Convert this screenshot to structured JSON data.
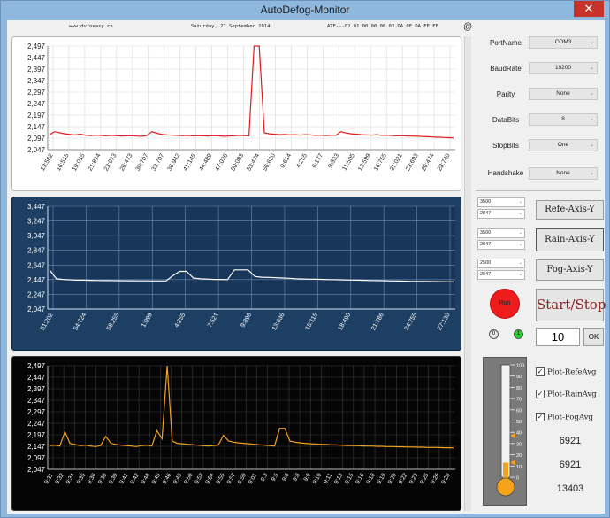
{
  "window": {
    "title": "AutoDefog-Monitor",
    "close_glyph": "✕"
  },
  "infobar": {
    "site": "www.dvfoeasy.cn",
    "date": "Saturday, 27 September 2014",
    "packet": "ATE---02 01 00 00 00 03 DA 0E DA EE EF",
    "at_symbol": "@"
  },
  "serial": [
    {
      "label": "PortName",
      "value": "COM3"
    },
    {
      "label": "BaudRate",
      "value": "19200"
    },
    {
      "label": "Parity",
      "value": "None"
    },
    {
      "label": "DataBits",
      "value": "8"
    },
    {
      "label": "StopBits",
      "value": "One"
    },
    {
      "label": "Handshake",
      "value": "None"
    }
  ],
  "axis_controls": [
    {
      "max": "3500",
      "min": "2047",
      "button": "Refe-Axis-Y"
    },
    {
      "max": "3500",
      "min": "2047",
      "button": "Rain-Axis-Y"
    },
    {
      "max": "2500",
      "min": "2047",
      "button": "Fog-Axis-Y"
    }
  ],
  "run": {
    "label": "Run",
    "start_stop": "Start/Stop",
    "dot1": "0",
    "dot2": "1",
    "interval": "10",
    "ok": "OK"
  },
  "plot_options": [
    {
      "label": "Plot-RefeAvg",
      "checked": true,
      "mark": "✓"
    },
    {
      "label": "Plot-RainAvg",
      "checked": true,
      "mark": "✓"
    },
    {
      "label": "Plot-FogAvg",
      "checked": true,
      "mark": "✓"
    }
  ],
  "averages": [
    "6921",
    "6921",
    "13403"
  ],
  "thermometer": {
    "ticks": [
      "100",
      "90",
      "80",
      "70",
      "60",
      "50",
      "40",
      "30",
      "20",
      "10",
      "0"
    ],
    "level": 0.13,
    "marker_high": 0.37
  },
  "colors": {
    "refe_line": "#e01a1a",
    "rain_line": "#ffffff",
    "fog_line": "#f3a21c",
    "rain_bg": "#1d3f64",
    "fog_bg": "#050505"
  },
  "chart_data": [
    {
      "type": "line",
      "name": "refe",
      "ylim": [
        2047,
        2497
      ],
      "yticks": [
        "2,497",
        "2,447",
        "2,397",
        "2,347",
        "2,297",
        "2,247",
        "2,197",
        "2,147",
        "2,097",
        "2,047"
      ],
      "xticks": [
        "13:562",
        "16:515",
        "19:015",
        "21:874",
        "23:973",
        "26:473",
        "30:707",
        "33:707",
        "36:942",
        "41:145",
        "44:489",
        "47:036",
        "50:083",
        "53:474",
        "56:630",
        "0:614",
        "4:255",
        "6:177",
        "9:333",
        "11:505",
        "13:599",
        "16:755",
        "21:021",
        "23:693",
        "26:474",
        "28:740"
      ],
      "values": [
        2112,
        2125,
        2120,
        2116,
        2113,
        2111,
        2114,
        2110,
        2108,
        2110,
        2109,
        2107,
        2109,
        2108,
        2106,
        2107,
        2108,
        2106,
        2105,
        2108,
        2125,
        2118,
        2113,
        2111,
        2110,
        2109,
        2108,
        2109,
        2107,
        2108,
        2107,
        2106,
        2108,
        2107,
        2105,
        2106,
        2107,
        2109,
        2108,
        2107,
        2497,
        2497,
        2120,
        2116,
        2114,
        2112,
        2113,
        2111,
        2112,
        2110,
        2112,
        2111,
        2109,
        2110,
        2108,
        2110,
        2109,
        2125,
        2119,
        2116,
        2114,
        2112,
        2111,
        2110,
        2112,
        2109,
        2110,
        2108,
        2107,
        2108,
        2106,
        2106,
        2105,
        2104,
        2103,
        2102,
        2101,
        2100,
        2099,
        2098
      ]
    },
    {
      "type": "line",
      "name": "rain",
      "ylim": [
        2047,
        3447
      ],
      "yticks": [
        "3,447",
        "3,247",
        "3,047",
        "2,847",
        "2,647",
        "2,447",
        "2,247",
        "2,047"
      ],
      "xticks": [
        "51:202",
        "54:724",
        "58:255",
        "1:099",
        "4:255",
        "7:521",
        "9:896",
        "13:036",
        "15:115",
        "18:490",
        "21:786",
        "24:755",
        "27:130"
      ],
      "values": [
        2580,
        2460,
        2450,
        2445,
        2440,
        2440,
        2438,
        2436,
        2435,
        2434,
        2433,
        2432,
        2432,
        2431,
        2431,
        2430,
        2430,
        2430,
        2500,
        2560,
        2560,
        2470,
        2460,
        2455,
        2450,
        2450,
        2448,
        2580,
        2580,
        2580,
        2490,
        2480,
        2478,
        2474,
        2470,
        2466,
        2460,
        2456,
        2454,
        2452,
        2450,
        2448,
        2446,
        2444,
        2442,
        2440,
        2438,
        2436,
        2434,
        2432,
        2430,
        2428,
        2426,
        2424,
        2423,
        2422,
        2421,
        2420,
        2419,
        2418
      ]
    },
    {
      "type": "line",
      "name": "fog",
      "ylim": [
        2047,
        2497
      ],
      "yticks": [
        "2,497",
        "2,447",
        "2,397",
        "2,347",
        "2,297",
        "2,247",
        "2,197",
        "2,147",
        "2,097",
        "2,047"
      ],
      "xticks": [
        "9:31",
        "9:32",
        "9:34",
        "9:35",
        "9:36",
        "9:38",
        "9:39",
        "9:41",
        "9:42",
        "9:44",
        "9:45",
        "9:46",
        "9:48",
        "9:50",
        "9:52",
        "9:54",
        "9:55",
        "9:57",
        "9:59",
        "9:01",
        "9:3",
        "9:5",
        "9:6",
        "9:8",
        "9:9",
        "9:10",
        "9:11",
        "9:13",
        "9:15",
        "9:16",
        "9:18",
        "9:19",
        "9:20",
        "9:22",
        "9:23",
        "9:25",
        "9:26",
        "9:28"
      ],
      "values": [
        2150,
        2152,
        2148,
        2210,
        2160,
        2155,
        2150,
        2152,
        2148,
        2146,
        2150,
        2190,
        2160,
        2155,
        2152,
        2150,
        2148,
        2146,
        2150,
        2152,
        2148,
        2215,
        2180,
        2497,
        2170,
        2160,
        2158,
        2156,
        2154,
        2152,
        2150,
        2148,
        2150,
        2152,
        2195,
        2170,
        2165,
        2162,
        2160,
        2158,
        2156,
        2154,
        2152,
        2150,
        2148,
        2225,
        2225,
        2170,
        2165,
        2162,
        2160,
        2158,
        2157,
        2156,
        2155,
        2154,
        2153,
        2152,
        2151,
        2150,
        2150,
        2149,
        2148,
        2148,
        2147,
        2147,
        2146,
        2146,
        2145,
        2145,
        2144,
        2144,
        2143,
        2143,
        2142,
        2142,
        2142,
        2141,
        2141,
        2140
      ]
    }
  ]
}
